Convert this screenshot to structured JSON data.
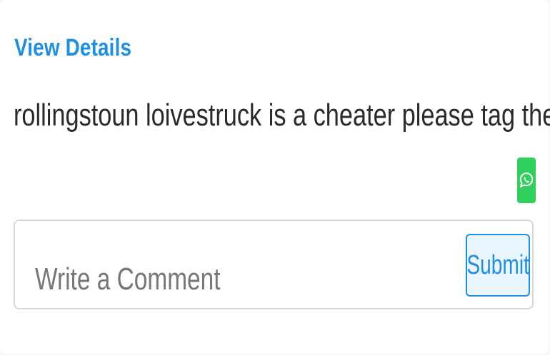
{
  "post": {
    "view_details_label": "View Details",
    "text": "rollingstoun loivestruck is a cheater please tag them"
  },
  "share": {
    "icon": "whatsapp-icon",
    "color": "#2fd15c"
  },
  "comment": {
    "placeholder": "Write a Comment",
    "value": "",
    "submit_label": "Submit"
  },
  "colors": {
    "accent": "#1e8fe1",
    "text": "#2a2a2a",
    "placeholder": "#777777",
    "border": "#d7d7d7"
  }
}
